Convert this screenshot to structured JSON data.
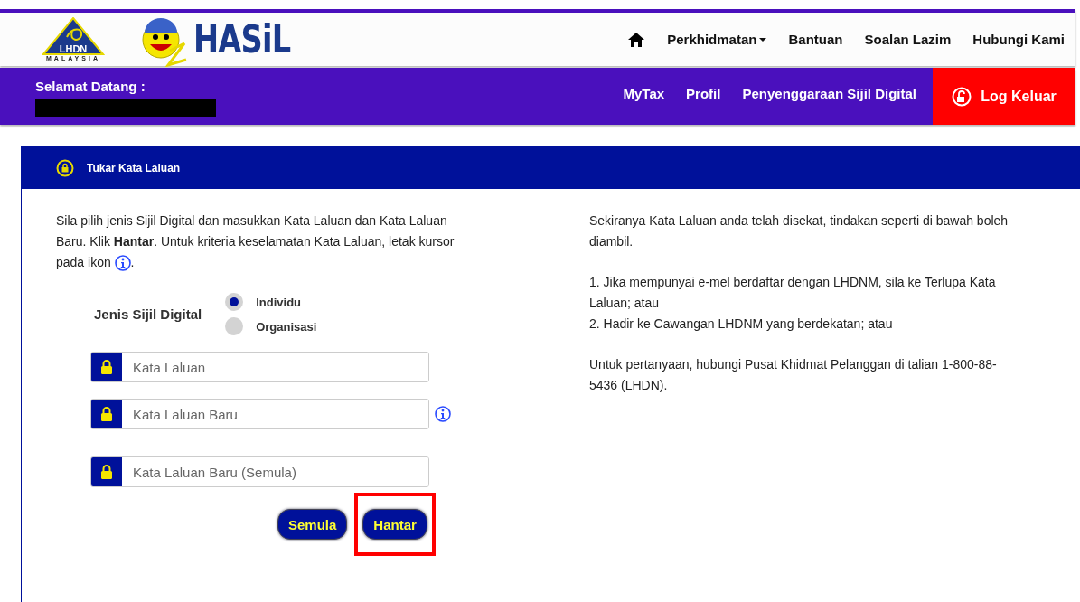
{
  "header": {
    "logo_main": "LHDN",
    "logo_sub": "MALAYSIA",
    "brand": "HASiL",
    "nav": [
      {
        "label": "Perkhidmatan",
        "dropdown": true
      },
      {
        "label": "Bantuan",
        "dropdown": false
      },
      {
        "label": "Soalan Lazim",
        "dropdown": false
      },
      {
        "label": "Hubungi Kami",
        "dropdown": false
      }
    ]
  },
  "userbar": {
    "greeting": "Selamat Datang :",
    "links": [
      "MyTax",
      "Profil",
      "Penyenggaraan Sijil Digital"
    ],
    "logout": "Log Keluar"
  },
  "panel": {
    "title": "Tukar Kata Laluan",
    "intro": "Sila pilih jenis Sijil Digital dan masukkan Kata Laluan dan Kata Laluan Baru. Klik **Hantar**. Untuk kriteria keselamatan Kata Laluan, letak kursor pada ikon",
    "intro_end": ".",
    "cert_label": "Jenis Sijil Digital",
    "cert_options": [
      {
        "label": "Individu",
        "selected": true
      },
      {
        "label": "Organisasi",
        "selected": false
      }
    ],
    "fields": [
      {
        "placeholder": "Kata Laluan",
        "info": false
      },
      {
        "placeholder": "Kata Laluan Baru",
        "info": true
      },
      {
        "placeholder": "Kata Laluan Baru (Semula)",
        "info": false
      }
    ],
    "buttons": [
      {
        "label": "Semula",
        "highlighted": false
      },
      {
        "label": "Hantar",
        "highlighted": true
      }
    ],
    "notes": [
      "Sekiranya Kata Laluan anda telah disekat, tindakan seperti di bawah boleh diambil.",
      "1. Jika mempunyai e-mel berdaftar dengan LHDNM, sila ke Terlupa Kata Laluan; atau\n2. Hadir ke Cawangan LHDNM yang berdekatan; atau",
      "Untuk pertanyaan, hubungi Pusat Khidmat Pelanggan di talian 1-800-88-5436 (LHDN)."
    ]
  }
}
